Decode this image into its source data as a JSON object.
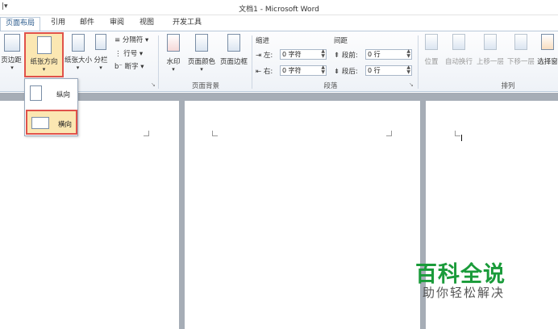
{
  "window": {
    "title": "文档1 - Microsoft Word",
    "qat": "|▾"
  },
  "tabs": [
    "页面布局",
    "引用",
    "邮件",
    "审阅",
    "视图",
    "开发工具"
  ],
  "ribbon": {
    "page_setup": {
      "margins": "页边距",
      "orientation": "纸张方向",
      "size": "纸张大小",
      "columns": "分栏",
      "breaks": "分隔符",
      "line_numbers": "行号",
      "hyphenation": "断字"
    },
    "page_background": {
      "group_label": "页面背景",
      "watermark": "水印",
      "page_color": "页面颜色",
      "page_borders": "页面边框"
    },
    "paragraph": {
      "group_label": "段落",
      "indent_title": "缩进",
      "indent_left_label": "左:",
      "indent_left_value": "0 字符",
      "indent_right_label": "右:",
      "indent_right_value": "0 字符",
      "spacing_title": "间距",
      "spacing_before_label": "段前:",
      "spacing_before_value": "0 行",
      "spacing_after_label": "段后:",
      "spacing_after_value": "0 行"
    },
    "arrange": {
      "group_label": "排列",
      "position": "位置",
      "wrap_text": "自动换行",
      "bring_forward": "上移一层",
      "send_backward": "下移一层",
      "selection_pane": "选择窗"
    }
  },
  "orientation_menu": {
    "portrait": "纵向",
    "landscape": "横向"
  },
  "watermark": {
    "line1": "百科全说",
    "line2": "助你轻松解决"
  },
  "colors": {
    "highlight": "#e0524a",
    "watermark_green": "#1a9b3a"
  }
}
